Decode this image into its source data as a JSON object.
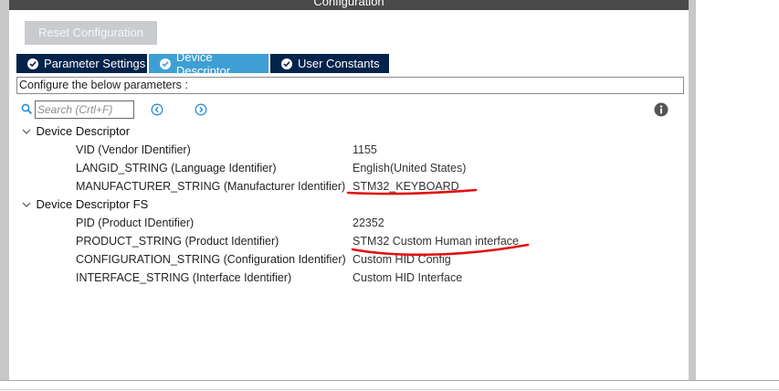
{
  "window": {
    "title": "Configuration"
  },
  "toolbar": {
    "reset_label": "Reset Configuration"
  },
  "tabs": [
    {
      "label": "Parameter Settings",
      "active": false
    },
    {
      "label": "Device Descriptor",
      "active": true
    },
    {
      "label": "User Constants",
      "active": false
    }
  ],
  "configure_label": "Configure the below parameters :",
  "search": {
    "placeholder": "Search (Crtl+F)"
  },
  "groups": [
    {
      "label": "Device Descriptor",
      "items": [
        {
          "name": "VID (Vendor IDentifier)",
          "value": "1155"
        },
        {
          "name": "LANGID_STRING (Language Identifier)",
          "value": "English(United States)"
        },
        {
          "name": "MANUFACTURER_STRING (Manufacturer Identifier)",
          "value": "STM32_KEYBOARD"
        }
      ]
    },
    {
      "label": "Device Descriptor FS",
      "items": [
        {
          "name": "PID (Product IDentifier)",
          "value": "22352"
        },
        {
          "name": "PRODUCT_STRING (Product Identifier)",
          "value": "STM32 Custom Human interface"
        },
        {
          "name": "CONFIGURATION_STRING (Configuration Identifier)",
          "value": "Custom HID Config"
        },
        {
          "name": "INTERFACE_STRING (Interface Identifier)",
          "value": "Custom HID Interface"
        }
      ]
    }
  ],
  "colors": {
    "tab_bg": "#03234b",
    "tab_active_bg": "#3f9fd4",
    "annotation_red": "#e01010",
    "accent_blue": "#2a8fd0"
  },
  "icons": [
    "search-icon",
    "arrow-left-circle-icon",
    "arrow-right-circle-icon",
    "info-icon",
    "chevron-down-icon",
    "check-circle-icon"
  ]
}
